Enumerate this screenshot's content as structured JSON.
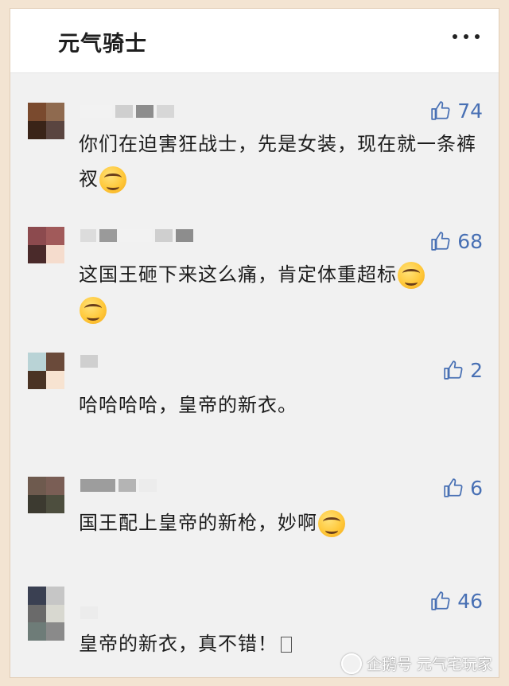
{
  "header": {
    "title": "元气骑士",
    "more_icon": "more-dots-icon"
  },
  "colors": {
    "like_blue": "#4870b4",
    "background": "#f1f1f1"
  },
  "comments": [
    {
      "likes": "74",
      "text": "你们在迫害狂战士，先是女装，现在就一条裤衩",
      "text_line2": "",
      "emoji": "smirk-emoji"
    },
    {
      "likes": "68",
      "text": "这国王砸下来这么痛，肯定体重超标",
      "emoji": "smirk-emoji"
    },
    {
      "likes": "2",
      "text": "哈哈哈哈，皇帝的新衣。"
    },
    {
      "likes": "6",
      "text": "国王配上皇帝的新枪，妙啊",
      "emoji": "smirk-emoji"
    },
    {
      "likes": "46",
      "text": "皇帝的新衣，真不错！"
    }
  ],
  "watermark": {
    "text": "企鹅号 元气宅玩家"
  }
}
